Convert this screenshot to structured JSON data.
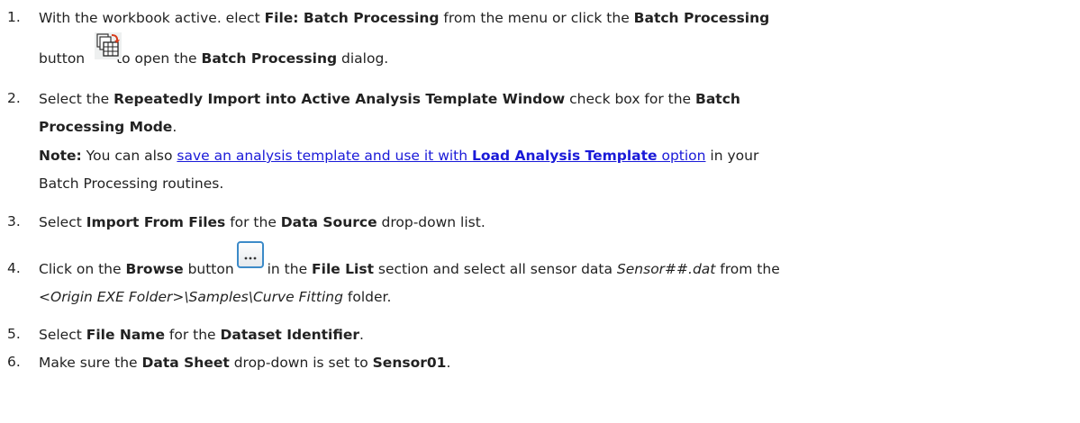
{
  "steps": [
    {
      "num": "1.",
      "line1": [
        "With the workbook active. elect ",
        "File: Batch Processing",
        " from the menu or click the ",
        "Batch Processing"
      ],
      "line2": [
        "button ",
        "to open the ",
        "Batch Processing",
        " dialog."
      ],
      "icon": "batch-processing-icon"
    },
    {
      "num": "2.",
      "line1": [
        "Select the ",
        "Repeatedly Import into Active Analysis Template Window",
        " check box for the ",
        "Batch"
      ],
      "line2": [
        "Processing Mode",
        "."
      ],
      "note_line1": [
        "Note:",
        " You can also ",
        "save an analysis template and use it with ",
        "Load Analysis Template",
        " option",
        " in your"
      ],
      "note_line2": "Batch Processing routines."
    },
    {
      "num": "3.",
      "line1": [
        "Select ",
        "Import From Files",
        " for the ",
        "Data Source",
        " drop-down list."
      ]
    },
    {
      "num": "4.",
      "line1": [
        "Click on the ",
        "Browse",
        " button ",
        "in the ",
        "File List",
        " section and select all sensor data ",
        "Sensor##.dat",
        " from the"
      ],
      "line2": [
        "<Origin EXE Folder>\\Samples\\Curve Fitting",
        " folder."
      ],
      "icon": "browse-icon"
    },
    {
      "num": "5.",
      "line1": [
        "Select ",
        "File Name",
        " for the ",
        "Dataset Identifier",
        "."
      ]
    },
    {
      "num": "6.",
      "line1": [
        "Make sure the ",
        "Data Sheet",
        " drop-down is set to ",
        "Sensor01",
        "."
      ]
    }
  ],
  "colors": {
    "text": "#222222",
    "link": "#1a1ad8"
  }
}
